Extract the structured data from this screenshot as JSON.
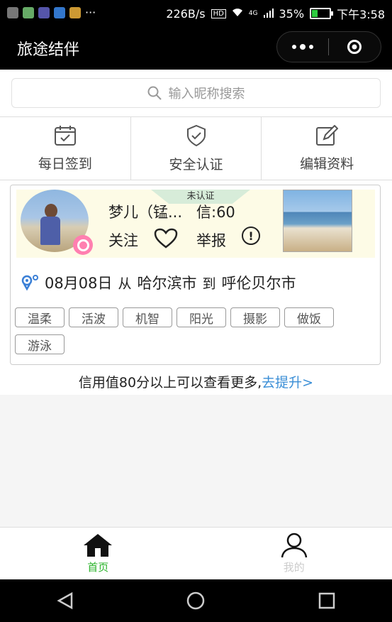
{
  "status_bar": {
    "speed": "226B/s",
    "network": "4G",
    "battery": "35%",
    "battery_level": 0.35,
    "time": "下午3:58",
    "overflow": "···"
  },
  "header": {
    "title": "旅途结伴",
    "more_icon": "more-dots-icon",
    "close_icon": "target-icon"
  },
  "search": {
    "placeholder": "输入昵称搜索"
  },
  "actions": [
    {
      "label": "每日签到",
      "icon": "calendar-check-icon"
    },
    {
      "label": "安全认证",
      "icon": "shield-check-icon"
    },
    {
      "label": "编辑资料",
      "icon": "edit-icon"
    }
  ],
  "card": {
    "verify": "未认证",
    "name": "梦儿（锰...",
    "credit": "信:60",
    "follow": "关注",
    "report": "举报",
    "date": "08月08日",
    "from_word": "从",
    "from_city": "哈尔滨市",
    "to_word": "到",
    "to_city": "呼伦贝尔市",
    "tags": [
      "温柔",
      "活波",
      "机智",
      "阳光",
      "摄影",
      "做饭",
      "游泳"
    ]
  },
  "tip": {
    "text": "信用值80分以上可以查看更多,",
    "link": "去提升>"
  },
  "tabbar": {
    "home": "首页",
    "mine": "我的"
  },
  "colors": {
    "accent": "#2bb32b",
    "link": "#3a8ed6",
    "card_bg": "#fdfbe6",
    "gender": "#ff7fb0"
  }
}
